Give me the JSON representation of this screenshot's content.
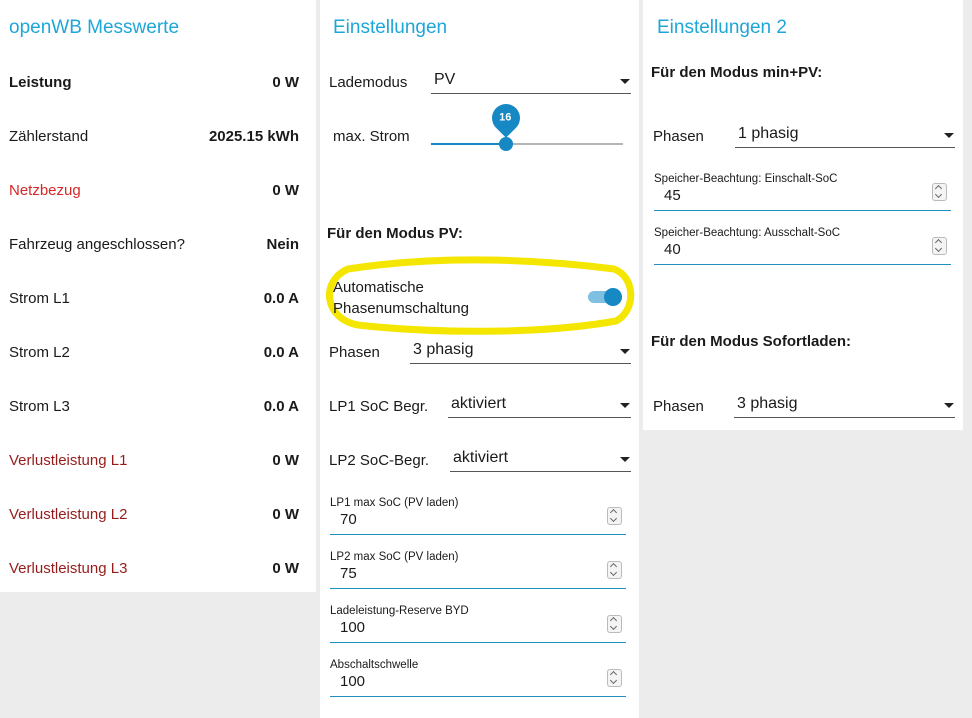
{
  "messwerte": {
    "title": "openWB Messwerte",
    "rows": [
      {
        "label": "Leistung",
        "value": "0 W",
        "bold_label": true
      },
      {
        "label": "Zählerstand",
        "value": "2025.15 kWh"
      },
      {
        "label": "Netzbezug",
        "value": "0 W"
      },
      {
        "label": "Fahrzeug angeschlossen?",
        "value": "Nein"
      },
      {
        "label": "Strom L1",
        "value": "0.0 A"
      },
      {
        "label": "Strom L2",
        "value": "0.0 A"
      },
      {
        "label": "Strom L3",
        "value": "0.0 A"
      },
      {
        "label": "Verlustleistung L1",
        "value": "0 W"
      },
      {
        "label": "Verlustleistung L2",
        "value": "0 W"
      },
      {
        "label": "Verlustleistung L3",
        "value": "0 W"
      }
    ]
  },
  "einstellungen": {
    "title": "Einstellungen",
    "lademodus_label": "Lademodus",
    "lademodus_value": "PV",
    "max_strom_label": "max. Strom",
    "max_strom_value": "16",
    "max_strom_fraction": 0.39,
    "pv_section": "Für den Modus PV:",
    "auto_phase_label_1": "Automatische",
    "auto_phase_label_2": "Phasenumschaltung",
    "auto_phase_on": true,
    "phasen_label": "Phasen",
    "phasen_value": "3 phasig",
    "lp1_soc_label": "LP1 SoC Begr.",
    "lp1_soc_value": "aktiviert",
    "lp2_soc_label": "LP2 SoC-Begr.",
    "lp2_soc_value": "aktiviert",
    "lp1_max_soc_label": "LP1 max SoC (PV laden)",
    "lp1_max_soc_value": "70",
    "lp2_max_soc_label": "LP2 max SoC (PV laden)",
    "lp2_max_soc_value": "75",
    "reserve_label": "Ladeleistung-Reserve BYD",
    "reserve_value": "100",
    "abschalt_label": "Abschaltschwelle",
    "abschalt_value": "100"
  },
  "einstellungen2": {
    "title": "Einstellungen 2",
    "minpv_section": "Für den Modus min+PV:",
    "phasen_label": "Phasen",
    "phasen_value": "1 phasig",
    "einschalt_label": "Speicher-Beachtung: Einschalt-SoC",
    "einschalt_value": "45",
    "ausschalt_label": "Speicher-Beachtung: Ausschalt-SoC",
    "ausschalt_value": "40",
    "sofort_section": "Für den Modus Sofortladen:",
    "sofort_phasen_label": "Phasen",
    "sofort_phasen_value": "3 phasig"
  },
  "colors": {
    "accent": "#1fa6d8",
    "slider": "#1688c4",
    "highlight": "#f5e600",
    "red": "#d72828",
    "darkred": "#961c1c"
  }
}
